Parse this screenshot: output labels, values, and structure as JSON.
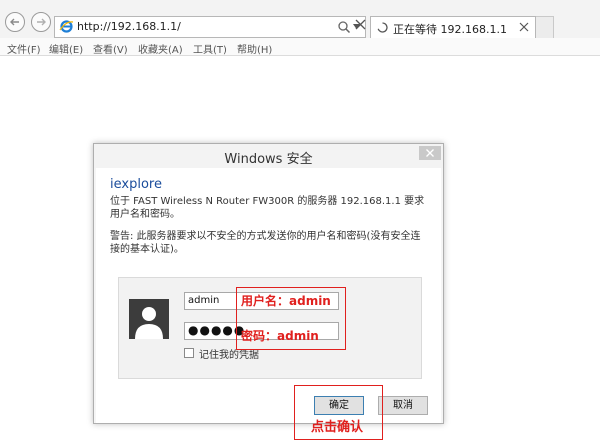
{
  "browser": {
    "address_url": "http://192.168.1.1/",
    "tab_title": "正在等待 192.168.1.1"
  },
  "menu": {
    "items": [
      "文件(F)",
      "编辑(E)",
      "查看(V)",
      "收藏夹(A)",
      "工具(T)",
      "帮助(H)"
    ]
  },
  "dialog": {
    "title": "Windows 安全",
    "app_name": "iexplore",
    "server_message": "位于 FAST Wireless N Router FW300R 的服务器 192.168.1.1 要求用户名和密码。",
    "warning_message": "警告: 此服务器要求以不安全的方式发送你的用户名和密码(没有安全连接的基本认证)。",
    "username_value": "admin",
    "password_mask": "●●●●●",
    "remember_label": "记住我的凭据",
    "remember_checked": false,
    "ok_label": "确定",
    "cancel_label": "取消"
  },
  "annotations": {
    "username_note": "用户名：admin",
    "password_note": "密码：admin",
    "click_note": "点击确认",
    "color": "#e0201e"
  },
  "icons": {
    "back": "back-arrow-icon",
    "forward": "forward-arrow-icon",
    "ie": "ie-logo-icon",
    "search": "search-icon",
    "refresh": "refresh-icon",
    "loading": "loading-spinner-icon",
    "close": "close-icon",
    "avatar": "user-avatar-icon"
  }
}
